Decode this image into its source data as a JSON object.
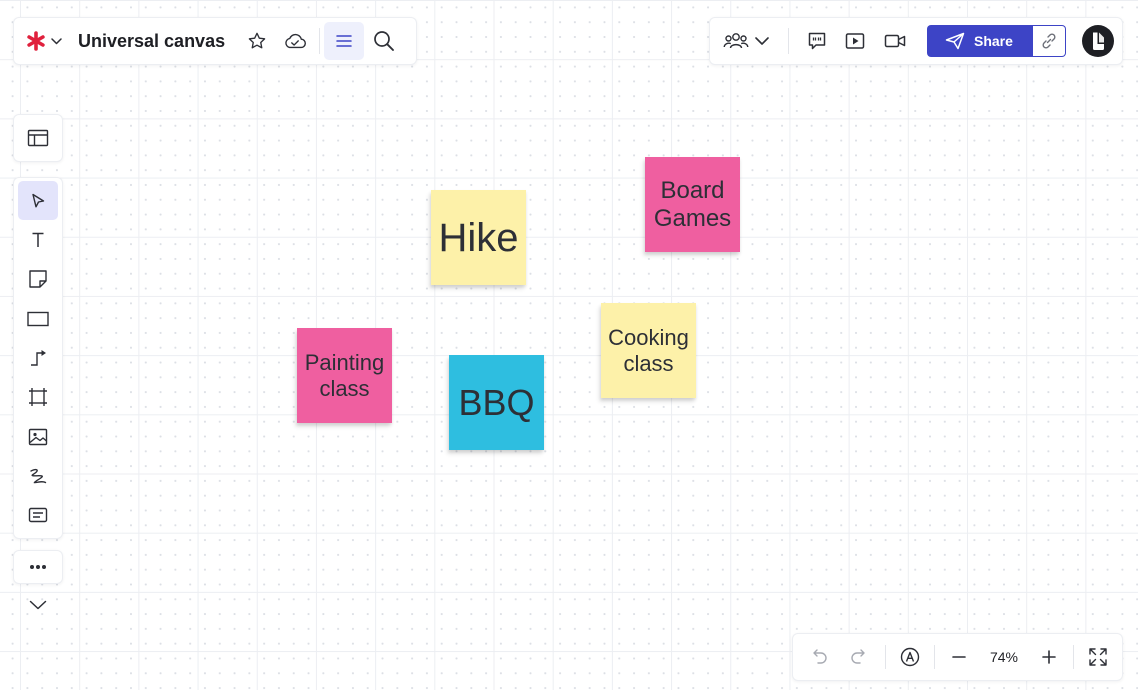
{
  "doc": {
    "title": "Universal canvas"
  },
  "toolbar": {
    "share_label": "Share"
  },
  "zoom": {
    "level": "74%"
  },
  "icons": {
    "logo": "asterisk-logo-icon",
    "star": "star-icon",
    "cloud": "cloud-check-icon",
    "menu": "menu-icon",
    "search": "search-icon",
    "collaborators": "collaborators-icon",
    "comments": "comment-icon",
    "present": "play-icon",
    "video": "video-camera-icon",
    "share": "send-icon",
    "link": "link-icon"
  },
  "colors": {
    "accent": "#3d44c6",
    "logo_red": "#e0213d",
    "sticky_yellow": "#fdf1a9",
    "sticky_pink": "#ef5fa0",
    "sticky_blue": "#2ebee0"
  },
  "stickies": [
    {
      "text": "Hike",
      "color": "#fdf1a9"
    },
    {
      "text": "Board Games",
      "color": "#ef5fa0"
    },
    {
      "text": "Cooking class",
      "color": "#fdf1a9"
    },
    {
      "text": "Painting class",
      "color": "#ef5fa0"
    },
    {
      "text": "BBQ",
      "color": "#2ebee0"
    }
  ]
}
